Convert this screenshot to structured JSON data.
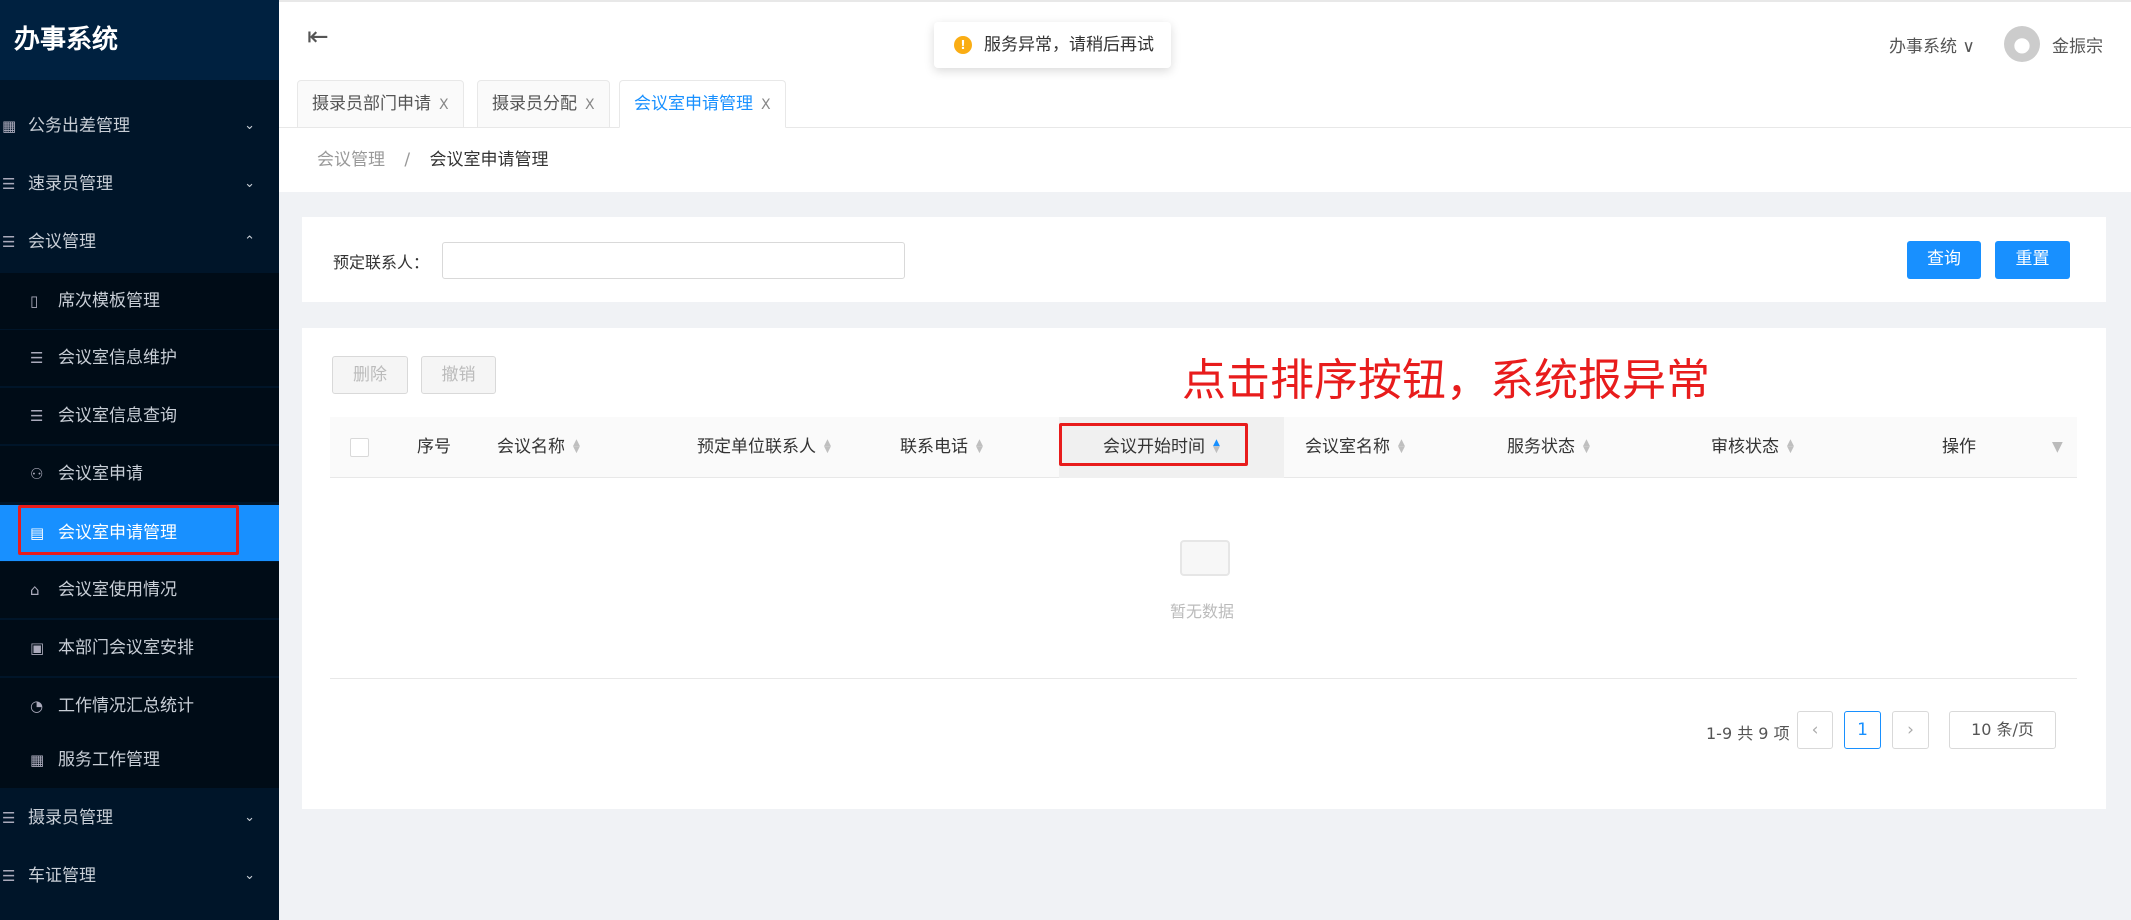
{
  "app": {
    "title": "办事系统"
  },
  "sidebar": {
    "items": [
      {
        "label": "公务出差管理",
        "icon": "grid-icon",
        "chevron": "⌄"
      },
      {
        "label": "速录员管理",
        "icon": "list-icon",
        "chevron": "⌄"
      },
      {
        "label": "会议管理",
        "icon": "list-icon",
        "chevron": "⌃"
      },
      {
        "label": "席次模板管理",
        "icon": "file-icon"
      },
      {
        "label": "会议室信息维护",
        "icon": "list-icon"
      },
      {
        "label": "会议室信息查询",
        "icon": "list-icon"
      },
      {
        "label": "会议室申请",
        "icon": "user-icon"
      },
      {
        "label": "会议室申请管理",
        "icon": "form-icon"
      },
      {
        "label": "会议室使用情况",
        "icon": "home-icon"
      },
      {
        "label": "本部门会议室安排",
        "icon": "doc-icon"
      },
      {
        "label": "工作情况汇总统计",
        "icon": "dashboard-icon"
      },
      {
        "label": "服务工作管理",
        "icon": "table-icon"
      },
      {
        "label": "摄录员管理",
        "icon": "list-icon",
        "chevron": "⌄"
      },
      {
        "label": "车证管理",
        "icon": "list-icon",
        "chevron": "⌄"
      }
    ]
  },
  "header": {
    "toast": "服务异常，请稍后再试",
    "system": "办事系统 ∨",
    "user": "金振宗"
  },
  "tabs": [
    {
      "label": "摄录员部门申请"
    },
    {
      "label": "摄录员分配"
    },
    {
      "label": "会议室申请管理"
    }
  ],
  "breadcrumb": {
    "parent": "会议管理",
    "sep": "/",
    "current": "会议室申请管理"
  },
  "filter": {
    "label": "预定联系人：",
    "value": "",
    "query": "查询",
    "reset": "重置"
  },
  "actions": {
    "delete": "删除",
    "revoke": "撤销"
  },
  "annotation": "点击排序按钮，系统报异常",
  "table": {
    "columns": [
      "序号",
      "会议名称",
      "预定单位联系人",
      "联系电话",
      "会议开始时间",
      "会议室名称",
      "服务状态",
      "审核状态",
      "操作"
    ],
    "empty": "暂无数据"
  },
  "pagination": {
    "total": "1-9 共 9 项",
    "page": "1",
    "size": "10 条/页"
  },
  "colors": {
    "primary": "#1890ff",
    "annotation": "#e81c1c",
    "sidebar": "#001529"
  }
}
